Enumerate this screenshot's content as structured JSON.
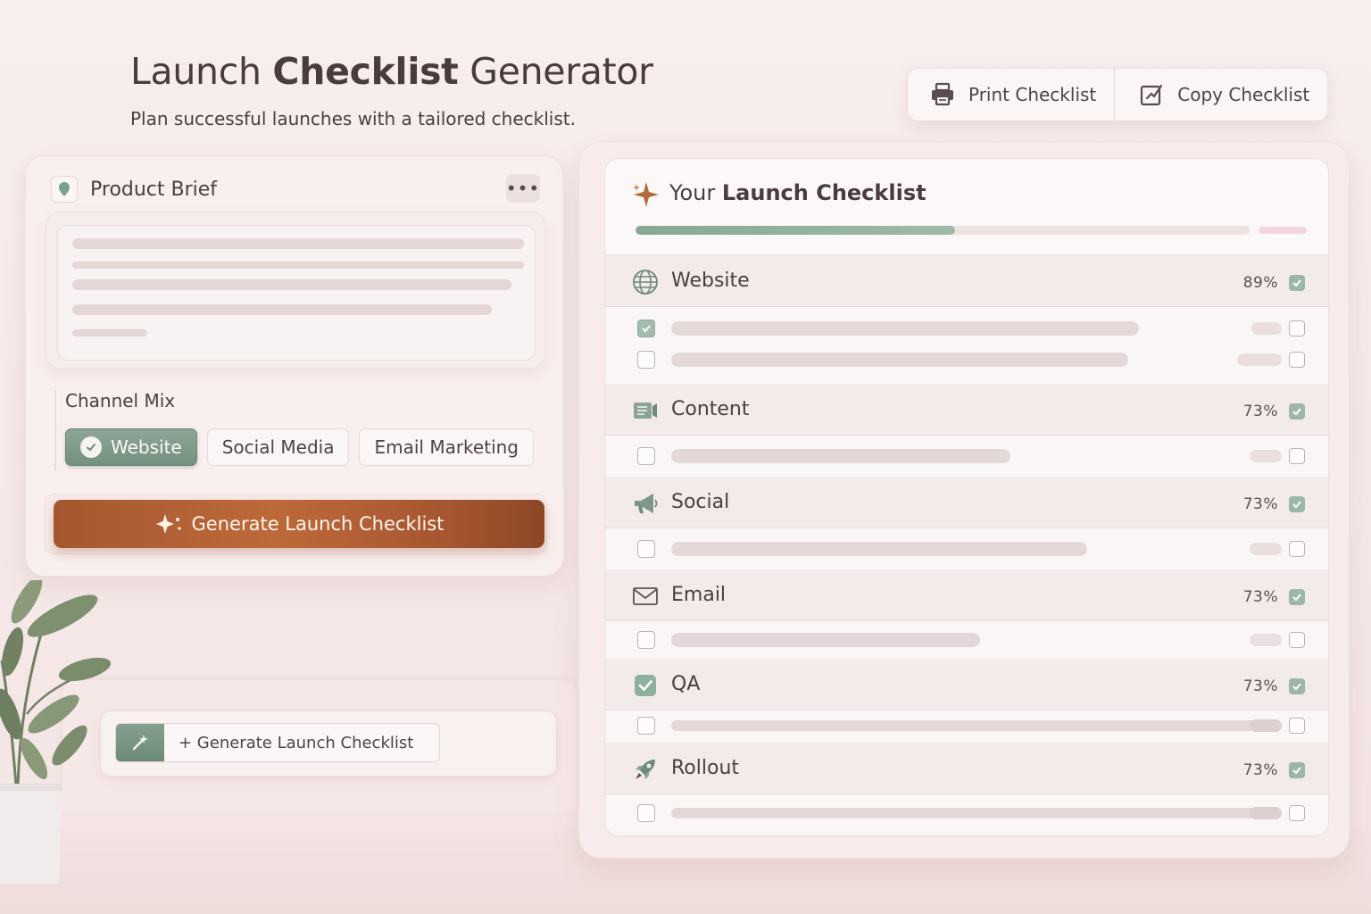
{
  "header": {
    "title_part1": "Launch ",
    "title_bold": "Checklist",
    "title_part2": " Generator",
    "subtitle": "Plan successful launches with a tailored checklist."
  },
  "actions": {
    "print_label": "Print Checklist",
    "copy_label": "Copy Checklist"
  },
  "brief": {
    "title": "Product Brief",
    "more_label": "•••",
    "channel_label": "Channel Mix",
    "channels": [
      {
        "label": "Website",
        "selected": true
      },
      {
        "label": "Social Media",
        "selected": false
      },
      {
        "label": "Email Marketing",
        "selected": false
      }
    ],
    "generate_label": "Generate Launch Checklist"
  },
  "mini_generate": {
    "label": "+ Generate Launch Checklist"
  },
  "checklist": {
    "title_prefix": "Your ",
    "title_bold": "Launch Checklist",
    "progress": 0.52,
    "sections": [
      {
        "name": "Website",
        "percent": "89%",
        "icon": "globe-icon"
      },
      {
        "name": "Content",
        "percent": "73%",
        "icon": "content-icon"
      },
      {
        "name": "Social",
        "percent": "73%",
        "icon": "megaphone-icon"
      },
      {
        "name": "Email",
        "percent": "73%",
        "icon": "envelope-icon"
      },
      {
        "name": "QA",
        "percent": "73%",
        "icon": "check-square-icon"
      },
      {
        "name": "Rollout",
        "percent": "73%",
        "icon": "rocket-icon"
      }
    ]
  },
  "colors": {
    "accent_green": "#74907f",
    "accent_copper": "#b0602f",
    "background": "#f8eeee"
  }
}
